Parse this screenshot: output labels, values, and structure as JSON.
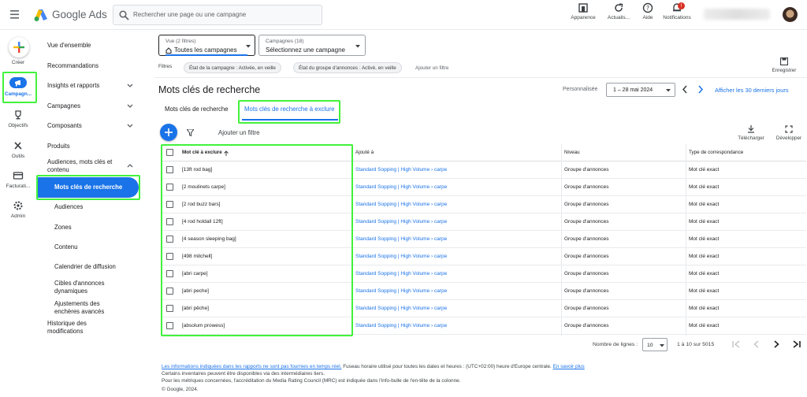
{
  "app": {
    "brand": "Google Ads",
    "menu_icon": "menu-icon",
    "logo_icon": "google-ads-logo"
  },
  "search": {
    "placeholder": "Rechercher une page ou une campagne"
  },
  "topbar": {
    "buttons": [
      {
        "label": "Apparence",
        "icon": "appearance-icon"
      },
      {
        "label": "Actualis...",
        "icon": "refresh-icon"
      },
      {
        "label": "Aide",
        "icon": "help-icon"
      },
      {
        "label": "Notifications",
        "icon": "bell-icon",
        "badge": "!"
      }
    ]
  },
  "rail": {
    "items": [
      {
        "label": "Créer",
        "icon": "plus-icon"
      },
      {
        "label": "Campagn...",
        "icon": "campaign-icon"
      },
      {
        "label": "Objectifs",
        "icon": "trophy-icon"
      },
      {
        "label": "Outils",
        "icon": "tools-icon"
      },
      {
        "label": "Facturati...",
        "icon": "billing-icon"
      },
      {
        "label": "Admin",
        "icon": "gear-icon"
      }
    ]
  },
  "nav": {
    "items": [
      "Vue d'ensemble",
      "Recommandations",
      "Insights et rapports",
      "Campagnes",
      "Composants",
      "Produits"
    ],
    "group_title": "Audiences, mots clés et contenu",
    "active": "Mots clés de recherche",
    "sub": [
      "Audiences",
      "Zones",
      "Contenu",
      "Calendrier de diffusion",
      "Cibles d'annonces dynamiques",
      "Ajustements des enchères avancés"
    ],
    "history": "Historique des modifications"
  },
  "filters": {
    "view_label": "Vue (2 filtres)",
    "view_value": "Toutes les campagnes",
    "campaigns_label": "Campagnes (18)",
    "campaigns_value": "Sélectionnez une campagne",
    "filtres_label": "Filtres",
    "chips": [
      "État de la campagne : Activée, en veille",
      "État du groupe d'annonces : Activé, en veille"
    ],
    "add_filter": "Ajouter un filtre",
    "save_label": "Enregistrer"
  },
  "page": {
    "title": "Mots clés de recherche",
    "date_mode": "Personnalisée",
    "date_range": "1 – 28 mai 2024",
    "last30": "Afficher les 30 derniers jours",
    "tabs": [
      "Mots clés de recherche",
      "Mots clés de recherche à exclure"
    ],
    "active_tab": 1,
    "toolbar_filter": "Ajouter un filtre",
    "download": "Télécharger",
    "develop": "Développer"
  },
  "table": {
    "columns": [
      "Mot clé à exclure",
      "Ajouté à",
      "Niveau",
      "Type de correspondance"
    ],
    "rows": [
      [
        "[13ft rod bag]",
        "Standard Sopping | High Volume › carpe",
        "Groupe d'annonces",
        "Mot clé exact"
      ],
      [
        "[2 moulinets carpe]",
        "Standard Sopping | High Volume › carpe",
        "Groupe d'annonces",
        "Mot clé exact"
      ],
      [
        "[2 rod buzz bars]",
        "Standard Sopping | High Volume › carpe",
        "Groupe d'annonces",
        "Mot clé exact"
      ],
      [
        "[4 rod holdall 12ft]",
        "Standard Sopping | High Volume › carpe",
        "Groupe d'annonces",
        "Mot clé exact"
      ],
      [
        "[4 season sleeping bag]",
        "Standard Sopping | High Volume › carpe",
        "Groupe d'annonces",
        "Mot clé exact"
      ],
      [
        "[498 mitchell]",
        "Standard Sopping | High Volume › carpe",
        "Groupe d'annonces",
        "Mot clé exact"
      ],
      [
        "[abri carpe]",
        "Standard Sopping | High Volume › carpe",
        "Groupe d'annonces",
        "Mot clé exact"
      ],
      [
        "[abri peche]",
        "Standard Sopping | High Volume › carpe",
        "Groupe d'annonces",
        "Mot clé exact"
      ],
      [
        "[abri pêche]",
        "Standard Sopping | High Volume › carpe",
        "Groupe d'annonces",
        "Mot clé exact"
      ],
      [
        "[absolum prowess]",
        "Standard Sopping | High Volume › carpe",
        "Groupe d'annonces",
        "Mot clé exact"
      ]
    ]
  },
  "pagination": {
    "rows_label": "Nombre de lignes :",
    "rows_value": "10",
    "range": "1 à 10 sur 5015"
  },
  "footer": {
    "link1": "Les informations indiquées dans les rapports ne sont pas fournies en temps réel.",
    "text1": " Fuseau horaire utilisé pour toutes les dates et heures : (UTC+02:00) heure d'Europe centrale. ",
    "link2": "En savoir plus",
    "line2": "Certains inventaires peuvent être disponibles via des intermédiaires tiers.",
    "line3": "Pour les métriques concernées, l'accréditation du Media Rating Council (MRC) est indiquée dans l'info-bulle de l'en-tête de la colonne.",
    "copyright": "© Google, 2024."
  },
  "colors": {
    "accent": "#1a73e8",
    "highlight": "#42f23b",
    "badge": "#d93025"
  }
}
